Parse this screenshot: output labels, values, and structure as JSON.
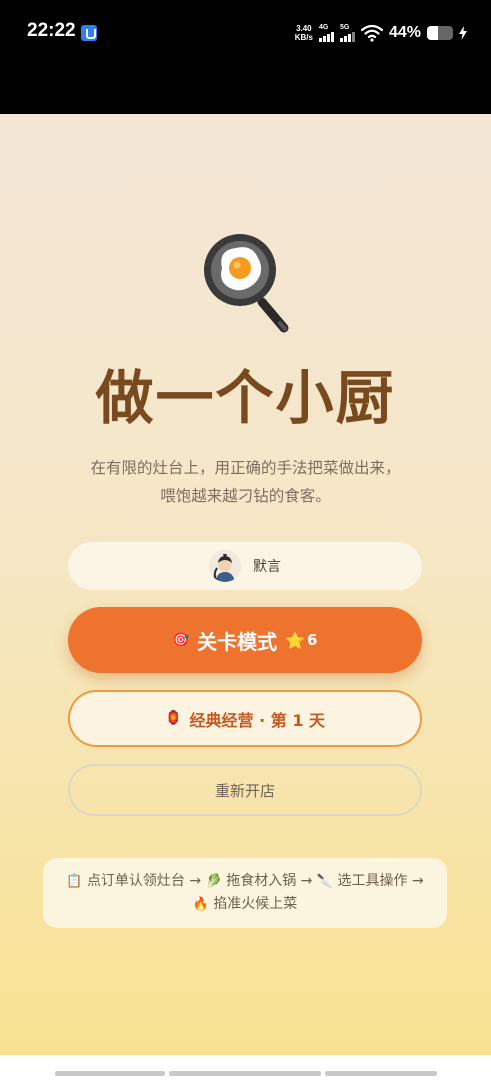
{
  "status_bar": {
    "time": "22:22",
    "net_speed_value": "3.40",
    "net_speed_unit": "KB/s",
    "signal1": "4G",
    "signal2": "5G",
    "battery_percent": "44%",
    "battery_level": 0.44
  },
  "app": {
    "icon": "frying-pan-egg",
    "title": "做一个小厨",
    "subtitle_line1": "在有限的灶台上，用正确的手法把菜做出来，",
    "subtitle_line2": "喂饱越来越刁钻的食客。",
    "user": {
      "name": "默言",
      "avatar": "avatar-person"
    },
    "level_button": {
      "icon": "🎯",
      "label": "关卡模式",
      "star_icon": "⭐",
      "stars": "6"
    },
    "classic_button": {
      "icon": "🏮",
      "label": "经典经营 · 第 1 天"
    },
    "reopen_button": {
      "label": "重新开店"
    },
    "instructions": {
      "icon1": "📋",
      "step1": "点订单认领灶台",
      "arrow": "→",
      "icon2": "🥬",
      "step2": "拖食材入锅",
      "icon3": "🔪",
      "step3": "选工具操作",
      "icon4": "🔥",
      "step4": "掐准火候上菜"
    }
  },
  "colors": {
    "primary": "#ee732f",
    "title": "#7a4a1f",
    "classic_border": "#ef9a3f",
    "classic_text": "#c45a1e"
  }
}
